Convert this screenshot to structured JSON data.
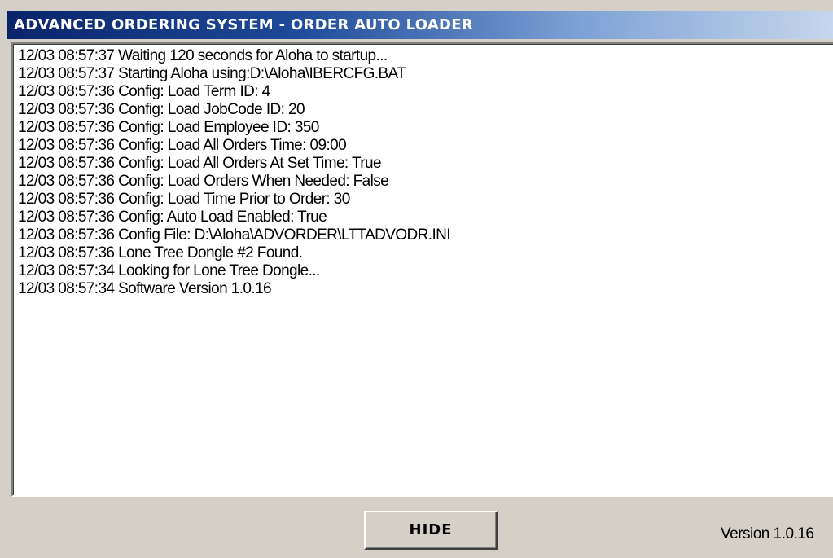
{
  "window": {
    "title": "ADVANCED ORDERING SYSTEM - ORDER AUTO LOADER"
  },
  "log": {
    "lines": [
      "12/03 08:57:37 Waiting 120 seconds for Aloha to startup...",
      "12/03 08:57:37 Starting Aloha using:D:\\Aloha\\IBERCFG.BAT",
      "12/03 08:57:36 Config: Load Term ID: 4",
      "12/03 08:57:36 Config: Load JobCode ID: 20",
      "12/03 08:57:36 Config: Load Employee ID: 350",
      "12/03 08:57:36 Config: Load All Orders Time: 09:00",
      "12/03 08:57:36 Config: Load All Orders At Set Time: True",
      "12/03 08:57:36 Config: Load Orders When Needed: False",
      "12/03 08:57:36 Config: Load Time Prior to Order: 30",
      "12/03 08:57:36 Config: Auto Load Enabled: True",
      "12/03 08:57:36 Config File: D:\\Aloha\\ADVORDER\\LTTADVODR.INI",
      "12/03 08:57:36 Lone Tree Dongle #2 Found.",
      "12/03 08:57:34 Looking for Lone Tree Dongle...",
      "12/03 08:57:34 Software Version 1.0.16"
    ]
  },
  "footer": {
    "hide_label": "HIDE",
    "version_text": "Version 1.0.16"
  },
  "colors": {
    "titlebar_start": "#0a246a",
    "titlebar_end": "#c6d6ec",
    "window_bg": "#d4d0c8"
  }
}
